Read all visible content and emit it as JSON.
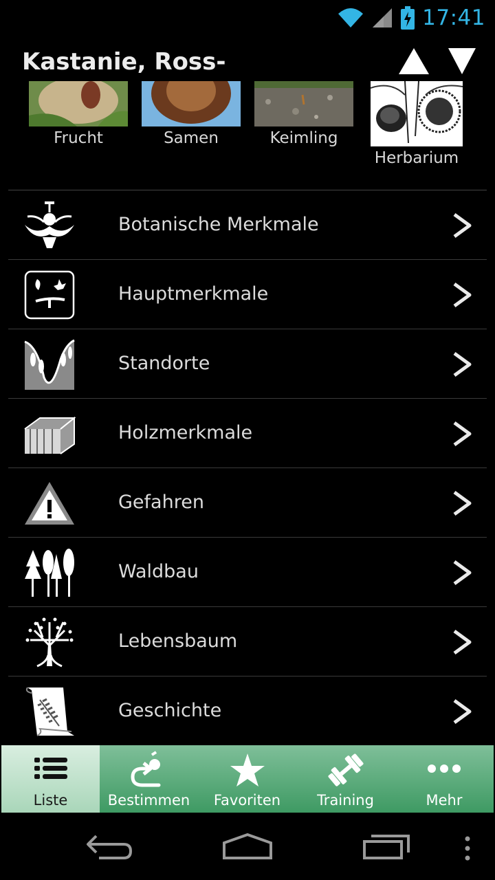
{
  "status": {
    "time": "17:41",
    "wifi_icon": "wifi-icon",
    "signal_icon": "signal-icon",
    "battery_icon": "battery-charging-icon",
    "accent": "#33b5e5"
  },
  "header": {
    "title": "Kastanie, Ross-",
    "up_icon": "arrow-up-icon",
    "down_icon": "arrow-down-icon"
  },
  "thumbnails": [
    {
      "label": "Frucht"
    },
    {
      "label": "Samen"
    },
    {
      "label": "Keimling"
    },
    {
      "label": "Herbarium"
    }
  ],
  "menu": [
    {
      "label": "Botanische Merkmale",
      "icon": "flower-icon"
    },
    {
      "label": "Hauptmerkmale",
      "icon": "leaf-twig-icon"
    },
    {
      "label": "Standorte",
      "icon": "landscape-icon"
    },
    {
      "label": "Holzmerkmale",
      "icon": "wood-plank-icon"
    },
    {
      "label": "Gefahren",
      "icon": "warning-icon"
    },
    {
      "label": "Waldbau",
      "icon": "trees-icon"
    },
    {
      "label": "Lebensbaum",
      "icon": "tree-of-life-icon"
    },
    {
      "label": "Geschichte",
      "icon": "scroll-icon"
    }
  ],
  "tabs": [
    {
      "label": "Liste",
      "icon": "list-icon",
      "active": true
    },
    {
      "label": "Bestimmen",
      "icon": "identify-icon",
      "active": false
    },
    {
      "label": "Favoriten",
      "icon": "star-icon",
      "active": false
    },
    {
      "label": "Training",
      "icon": "dumbbell-icon",
      "active": false
    },
    {
      "label": "Mehr",
      "icon": "more-icon",
      "active": false
    }
  ],
  "colors": {
    "tab_gradient_top": "#7fbf99",
    "tab_gradient_bottom": "#3e9a63",
    "tab_active": "#c4e4cf"
  }
}
